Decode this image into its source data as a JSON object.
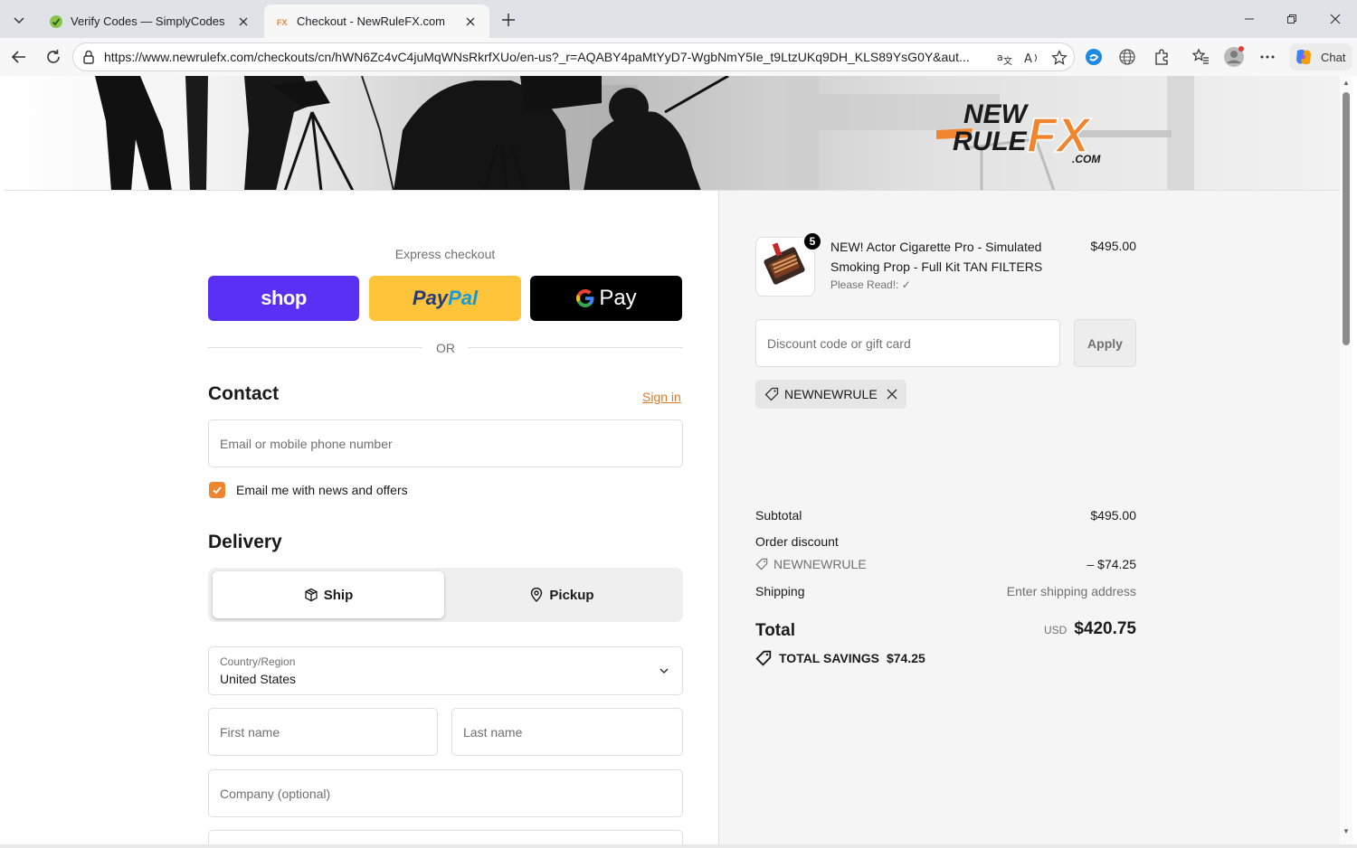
{
  "browser": {
    "tabs": [
      {
        "title": "Verify Codes — SimplyCodes",
        "active": false
      },
      {
        "title": "Checkout - NewRuleFX.com",
        "active": true
      }
    ],
    "url": "https://www.newrulefx.com/checkouts/cn/hWN6Zc4vC4juMqWNsRkrfXUo/en-us?_r=AQABY4paMtYyD7-WgbNmY5Ie_t9LtzUKq9DH_KLS89YsG0Y&aut...",
    "chat_label": "Chat"
  },
  "header": {
    "logo": {
      "line1": "NEW",
      "line2": "RULE",
      "fx": "FX",
      "suffix": ".COM"
    }
  },
  "checkout": {
    "express_label": "Express checkout",
    "shop_label": "shop",
    "paypal_label_1": "Pay",
    "paypal_label_2": "Pal",
    "gpay_label": "Pay",
    "or_label": "OR",
    "contact": {
      "heading": "Contact",
      "sign_in": "Sign in",
      "email_placeholder": "Email or mobile phone number",
      "newsletter_label": "Email me with news and offers",
      "newsletter_checked": true
    },
    "delivery": {
      "heading": "Delivery",
      "ship_label": "Ship",
      "pickup_label": "Pickup",
      "selected": "Ship",
      "country_label": "Country/Region",
      "country_value": "United States",
      "first_name_placeholder": "First name",
      "last_name_placeholder": "Last name",
      "company_placeholder": "Company (optional)"
    }
  },
  "summary": {
    "product": {
      "quantity": "5",
      "name": "NEW! Actor Cigarette Pro - Simulated Smoking Prop - Full Kit TAN FILTERS",
      "variant": "Please Read!: ✓",
      "price": "$495.00"
    },
    "discount_placeholder": "Discount code or gift card",
    "apply_label": "Apply",
    "applied_code": "NEWNEWRULE",
    "subtotal_label": "Subtotal",
    "subtotal_value": "$495.00",
    "order_discount_label": "Order discount",
    "discount_code": "NEWNEWRULE",
    "discount_value": "– $74.25",
    "shipping_label": "Shipping",
    "shipping_value": "Enter shipping address",
    "total_label": "Total",
    "currency": "USD",
    "total_value": "$420.75",
    "savings_label": "TOTAL SAVINGS",
    "savings_value": "$74.25"
  },
  "colors": {
    "accent_orange": "#f0852f",
    "shop_purple": "#5a31f4",
    "paypal_yellow": "#ffc439"
  }
}
